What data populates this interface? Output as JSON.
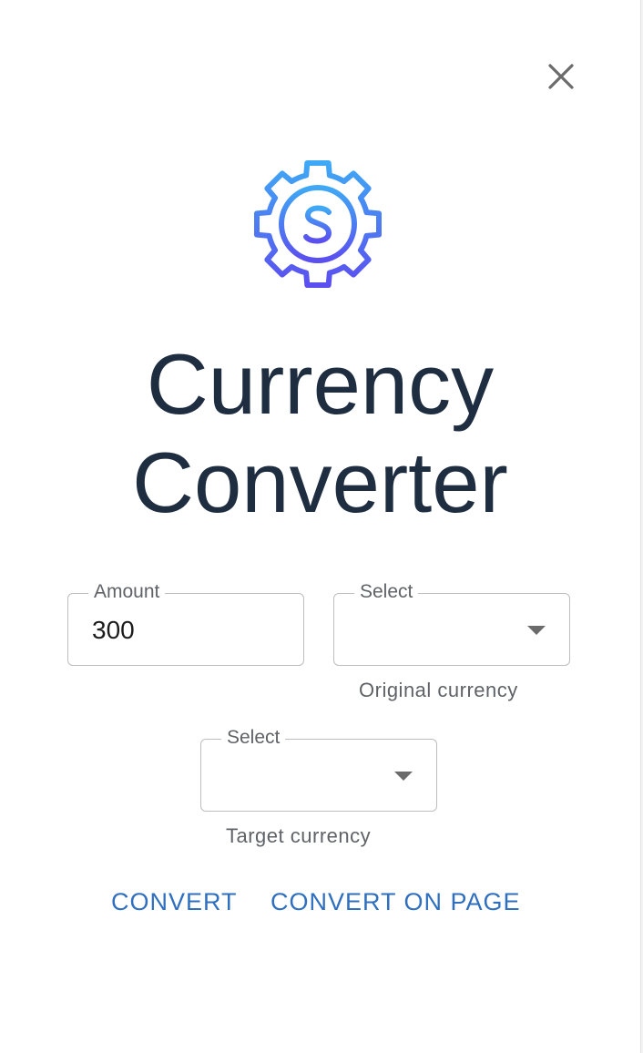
{
  "close": {
    "icon": "close-icon"
  },
  "logo": {
    "icon": "currency-gear-icon",
    "gradient": [
      "#3fa9f5",
      "#5b4ff0"
    ]
  },
  "title": {
    "line1": "Currency",
    "line2": "Converter"
  },
  "amount": {
    "label": "Amount",
    "value": "300"
  },
  "original_select": {
    "label": "Select",
    "helper": "Original currency"
  },
  "target_select": {
    "label": "Select",
    "helper": "Target currency"
  },
  "buttons": {
    "convert": "CONVERT",
    "convert_on_page": "CONVERT ON PAGE"
  },
  "colors": {
    "accent": "#2f6fbf",
    "title": "#1e2d40",
    "border": "#bdbdbd"
  }
}
